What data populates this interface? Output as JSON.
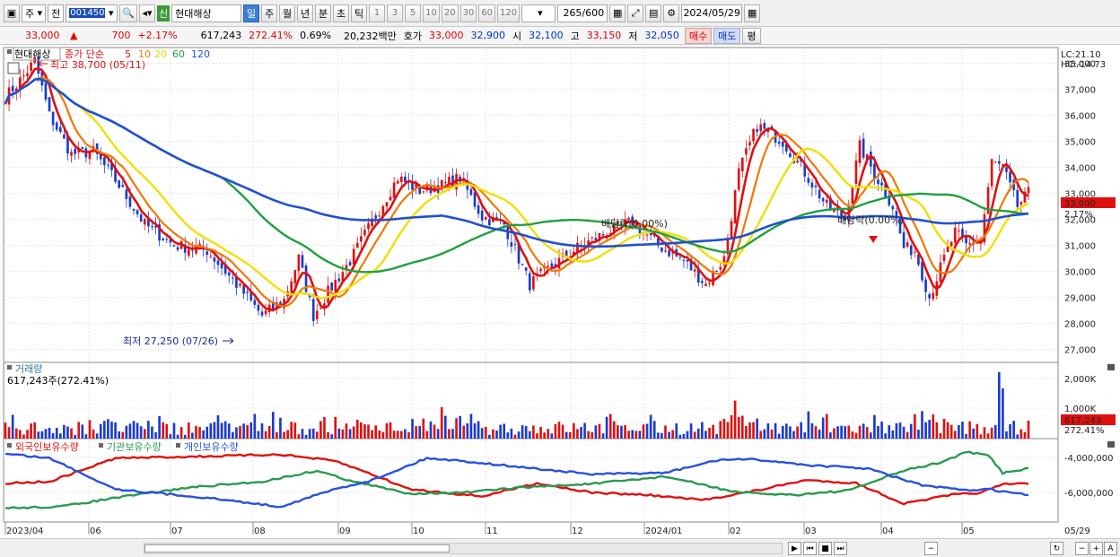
{
  "toolbar": {
    "market": "주",
    "prev_label": "전",
    "code": "001450",
    "sin_label": "신",
    "stock_name": "현대해상",
    "periods": [
      "일",
      "주",
      "월",
      "년",
      "분",
      "초",
      "틱"
    ],
    "numbers": [
      "1",
      "3",
      "5",
      "10",
      "20",
      "30",
      "60",
      "120"
    ],
    "count": "265",
    "count_total": "/600",
    "date": "2024/05/29"
  },
  "infobar": {
    "price": "33,000",
    "up_mark": "▲",
    "change": "700",
    "change_pct": "+2.17%",
    "volume": "617,243",
    "volume_pct": "272.41%",
    "turnover": "0.69%",
    "amount": "20,232백만",
    "hoga_label": "호가",
    "ask": "33,000",
    "bid": "32,900",
    "open_label": "시",
    "open": "32,100",
    "high_label": "고",
    "high": "33,150",
    "low_label": "저",
    "low": "32,050",
    "buy_label": "매수",
    "sell_label": "매도",
    "eval_label": "평"
  },
  "chart_data": [
    {
      "type": "candlestick",
      "title": "현대해상",
      "legend": {
        "ma_label": "종가 단순",
        "ma_periods": [
          "5",
          "10",
          "20",
          "60",
          "120"
        ],
        "ma_colors": [
          "#e01010",
          "#f07800",
          "#f0e000",
          "#20a040",
          "#2050d0"
        ]
      },
      "y_ticks": [
        "38,000",
        "37,000",
        "36,000",
        "35,000",
        "34,000",
        "33,000",
        "32,000",
        "31,000",
        "30,000",
        "29,000",
        "28,000",
        "27,000"
      ],
      "ylim": [
        26500,
        38600
      ],
      "x_ticks": [
        "2023/04",
        "06",
        "07",
        "08",
        "09",
        "10",
        "11",
        "12",
        "2024/01",
        "02",
        "03",
        "04",
        "05",
        "05/29"
      ],
      "annotations": {
        "high": "최고 38,700 (05/11)",
        "low": "최저 27,250 (07/26)",
        "dividend1": "배당락(0.00%)",
        "dividend2": "배당락(0.00%)",
        "lc": "LC:21.10",
        "hc": "HC:-14.73",
        "current_price": "33,000",
        "current_pct": "2.17%"
      },
      "anchors": [
        {
          "t": 0,
          "v": 36700
        },
        {
          "t": 5,
          "v": 37500
        },
        {
          "t": 8,
          "v": 38100
        },
        {
          "t": 12,
          "v": 36000
        },
        {
          "t": 18,
          "v": 34500
        },
        {
          "t": 24,
          "v": 34600
        },
        {
          "t": 30,
          "v": 33500
        },
        {
          "t": 38,
          "v": 31800
        },
        {
          "t": 46,
          "v": 31000
        },
        {
          "t": 55,
          "v": 30800
        },
        {
          "t": 63,
          "v": 29500
        },
        {
          "t": 70,
          "v": 28300
        },
        {
          "t": 76,
          "v": 28900
        },
        {
          "t": 80,
          "v": 30500
        },
        {
          "t": 84,
          "v": 28300
        },
        {
          "t": 88,
          "v": 29200
        },
        {
          "t": 94,
          "v": 30400
        },
        {
          "t": 100,
          "v": 31900
        },
        {
          "t": 107,
          "v": 33600
        },
        {
          "t": 113,
          "v": 33100
        },
        {
          "t": 119,
          "v": 33300
        },
        {
          "t": 124,
          "v": 33600
        },
        {
          "t": 130,
          "v": 32100
        },
        {
          "t": 136,
          "v": 31800
        },
        {
          "t": 143,
          "v": 29500
        },
        {
          "t": 149,
          "v": 30200
        },
        {
          "t": 156,
          "v": 30900
        },
        {
          "t": 164,
          "v": 31500
        },
        {
          "t": 171,
          "v": 31900
        },
        {
          "t": 178,
          "v": 31000
        },
        {
          "t": 185,
          "v": 30400
        },
        {
          "t": 191,
          "v": 29500
        },
        {
          "t": 196,
          "v": 30500
        },
        {
          "t": 200,
          "v": 33800
        },
        {
          "t": 205,
          "v": 35600
        },
        {
          "t": 212,
          "v": 35000
        },
        {
          "t": 218,
          "v": 33800
        },
        {
          "t": 224,
          "v": 32500
        },
        {
          "t": 229,
          "v": 32000
        },
        {
          "t": 233,
          "v": 34800
        },
        {
          "t": 238,
          "v": 33500
        },
        {
          "t": 242,
          "v": 32500
        },
        {
          "t": 245,
          "v": 30900
        },
        {
          "t": 248,
          "v": 30800
        },
        {
          "t": 252,
          "v": 29000
        },
        {
          "t": 256,
          "v": 30500
        },
        {
          "t": 259,
          "v": 31500
        },
        {
          "t": 262,
          "v": 31000
        },
        {
          "t": 266,
          "v": 31200
        },
        {
          "t": 269,
          "v": 34200
        },
        {
          "t": 272,
          "v": 34000
        },
        {
          "t": 276,
          "v": 32500
        },
        {
          "t": 279,
          "v": 33000
        }
      ]
    },
    {
      "type": "bar",
      "title": "거래량",
      "subtitle": "617,243주(272.41%)",
      "y_ticks": [
        "2,000K",
        "1,000K"
      ],
      "last_value": "617,243",
      "last_pct": "272.41%"
    },
    {
      "type": "line",
      "series_names": [
        "외국인보유수량",
        "기관보유수량",
        "개인보유수량"
      ],
      "series_colors": [
        "#e01010",
        "#2a9a50",
        "#2850e0"
      ],
      "y_ticks": [
        "-4,000,000",
        "-6,000,000"
      ],
      "foreigner": [
        {
          "t": 0,
          "v": 52
        },
        {
          "t": 12,
          "v": 50
        },
        {
          "t": 30,
          "v": 18
        },
        {
          "t": 60,
          "v": 15
        },
        {
          "t": 75,
          "v": 13
        },
        {
          "t": 90,
          "v": 22
        },
        {
          "t": 100,
          "v": 40
        },
        {
          "t": 110,
          "v": 60
        },
        {
          "t": 130,
          "v": 70
        },
        {
          "t": 145,
          "v": 52
        },
        {
          "t": 160,
          "v": 65
        },
        {
          "t": 175,
          "v": 68
        },
        {
          "t": 190,
          "v": 75
        },
        {
          "t": 205,
          "v": 62
        },
        {
          "t": 218,
          "v": 48
        },
        {
          "t": 232,
          "v": 52
        },
        {
          "t": 245,
          "v": 80
        },
        {
          "t": 258,
          "v": 68
        },
        {
          "t": 266,
          "v": 65
        },
        {
          "t": 272,
          "v": 54
        },
        {
          "t": 279,
          "v": 52
        }
      ],
      "institution": [
        {
          "t": 0,
          "v": 86
        },
        {
          "t": 15,
          "v": 84
        },
        {
          "t": 30,
          "v": 72
        },
        {
          "t": 50,
          "v": 58
        },
        {
          "t": 70,
          "v": 50
        },
        {
          "t": 85,
          "v": 35
        },
        {
          "t": 95,
          "v": 50
        },
        {
          "t": 110,
          "v": 66
        },
        {
          "t": 125,
          "v": 65
        },
        {
          "t": 140,
          "v": 58
        },
        {
          "t": 160,
          "v": 53
        },
        {
          "t": 180,
          "v": 43
        },
        {
          "t": 200,
          "v": 65
        },
        {
          "t": 215,
          "v": 68
        },
        {
          "t": 230,
          "v": 62
        },
        {
          "t": 245,
          "v": 35
        },
        {
          "t": 255,
          "v": 24
        },
        {
          "t": 262,
          "v": 10
        },
        {
          "t": 268,
          "v": 14
        },
        {
          "t": 272,
          "v": 38
        },
        {
          "t": 279,
          "v": 32
        }
      ],
      "individual": [
        {
          "t": 0,
          "v": 12
        },
        {
          "t": 12,
          "v": 18
        },
        {
          "t": 30,
          "v": 60
        },
        {
          "t": 55,
          "v": 72
        },
        {
          "t": 75,
          "v": 84
        },
        {
          "t": 90,
          "v": 60
        },
        {
          "t": 100,
          "v": 48
        },
        {
          "t": 115,
          "v": 18
        },
        {
          "t": 125,
          "v": 22
        },
        {
          "t": 140,
          "v": 30
        },
        {
          "t": 160,
          "v": 40
        },
        {
          "t": 180,
          "v": 38
        },
        {
          "t": 195,
          "v": 20
        },
        {
          "t": 205,
          "v": 20
        },
        {
          "t": 220,
          "v": 28
        },
        {
          "t": 235,
          "v": 32
        },
        {
          "t": 250,
          "v": 55
        },
        {
          "t": 262,
          "v": 62
        },
        {
          "t": 268,
          "v": 60
        },
        {
          "t": 274,
          "v": 65
        },
        {
          "t": 279,
          "v": 68
        }
      ]
    }
  ]
}
